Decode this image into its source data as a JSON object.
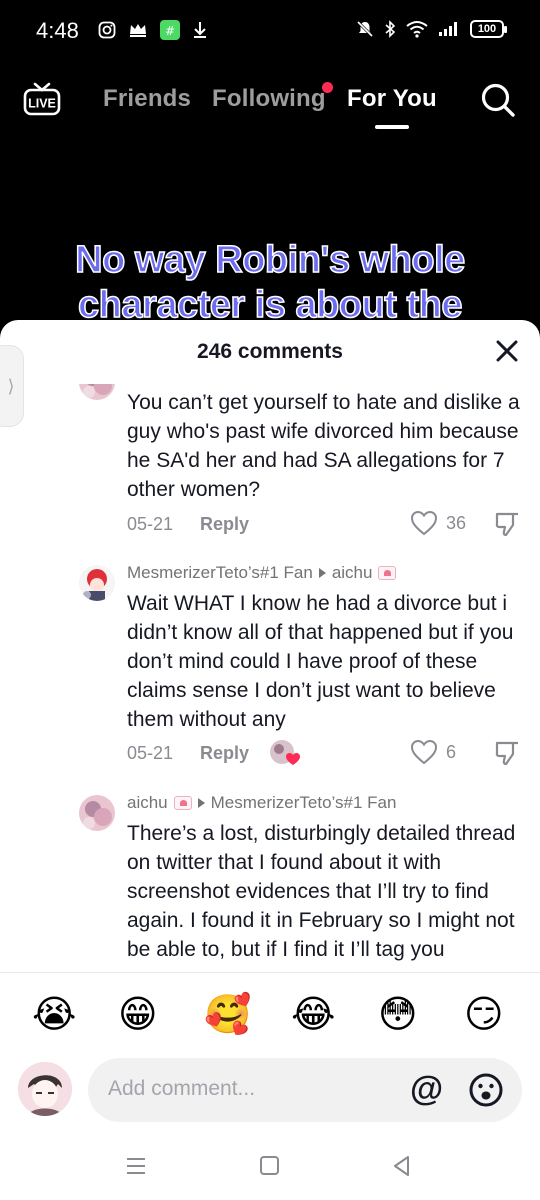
{
  "status_bar": {
    "time": "4:48",
    "battery": "100",
    "left_icons": [
      "instagram-icon",
      "crown-icon",
      "app-icon",
      "download-icon"
    ],
    "right_icons": [
      "mute-icon",
      "bluetooth-icon",
      "wifi-icon",
      "signal-icon",
      "battery-icon"
    ]
  },
  "top_nav": {
    "live_label": "LIVE",
    "tabs": [
      {
        "label": "Friends",
        "active": false
      },
      {
        "label": "Following",
        "active": false,
        "has_dot": true
      },
      {
        "label": "For You",
        "active": true
      }
    ]
  },
  "video": {
    "caption_line1": "No way Robin's whole",
    "caption_line2": "character is about the"
  },
  "comments_sheet": {
    "title": "246 comments",
    "comments": [
      {
        "text": "You can’t get yourself to hate and dislike a guy who's past wife divorced him because he SA'd her and had SA allegations for 7 other women?",
        "date": "05-21",
        "reply_label": "Reply",
        "likes": "36"
      },
      {
        "author": "MesmerizerTeto’s#1 Fan",
        "reply_to": "aichu",
        "text": "Wait WHAT I know he had a divorce but i didn’t know all of that happened but if you don’t mind could I have proof of these claims sense I don’t just want to believe them without any",
        "date": "05-21",
        "reply_label": "Reply",
        "likes": "6"
      },
      {
        "author": "aichu",
        "reply_to": "MesmerizerTeto’s#1 Fan",
        "text": "There’s a lost, disturbingly detailed thread on twitter that I found about it with screenshot evidences that I’ll try to find again. I found it in February so I might not be able to, but if I find it I’ll tag you"
      }
    ],
    "quick_emojis": [
      "😭",
      "😁",
      "🥰",
      "😂",
      "😳",
      "😏"
    ],
    "input_placeholder": "Add comment...",
    "at_symbol": "@"
  },
  "colors": {
    "accent_red": "#fe2c55",
    "caption_purple": "#6b6cf0"
  }
}
